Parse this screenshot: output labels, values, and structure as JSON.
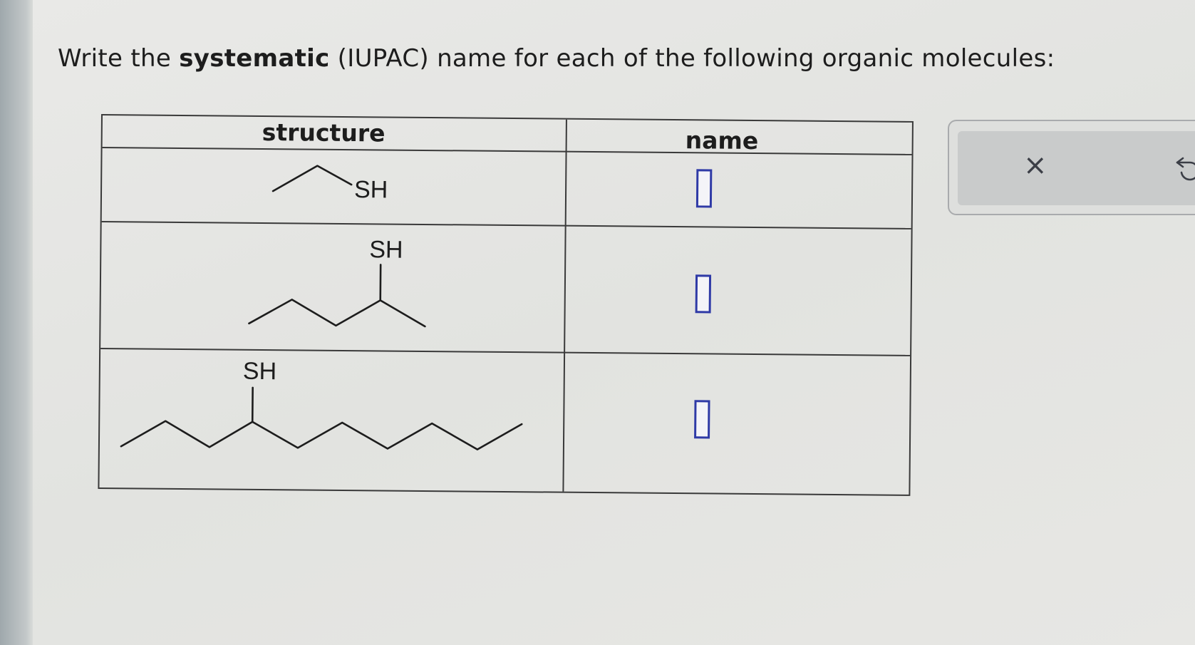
{
  "prompt": {
    "before": "Write the ",
    "bold": "systematic",
    "after": " (IUPAC) name for each of the following organic molecules:"
  },
  "table": {
    "headers": {
      "structure": "structure",
      "name": "name"
    },
    "rows": [
      {
        "substituent_label": "SH",
        "answer": ""
      },
      {
        "substituent_label": "SH",
        "answer": ""
      },
      {
        "substituent_label": "SH",
        "answer": ""
      }
    ]
  },
  "toolbar": {
    "clear_glyph": "×",
    "clear_icon": "close-icon",
    "undo_icon": "undo-icon"
  },
  "colors": {
    "answer_box_border": "#2f3aa6",
    "background": "#e4e5e2"
  }
}
